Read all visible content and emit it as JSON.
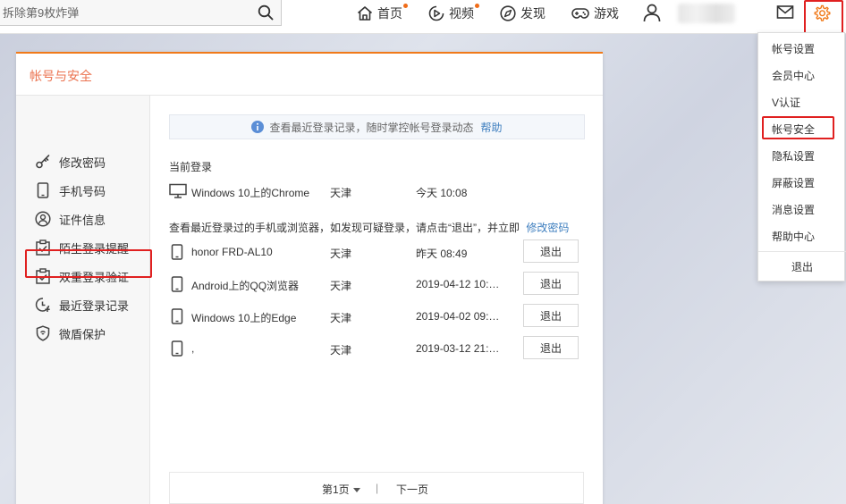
{
  "topbar": {
    "search_placeholder": "拆除第9枚炸弹",
    "nav": [
      {
        "label": "首页",
        "icon": "home-icon"
      },
      {
        "label": "视频",
        "icon": "video-icon"
      },
      {
        "label": "发现",
        "icon": "discover-icon"
      },
      {
        "label": "游戏",
        "icon": "game-icon"
      }
    ],
    "icons": [
      "user-icon",
      "mail-icon",
      "gear-icon"
    ],
    "accent": "#f07a1a",
    "highlight": "#e02020"
  },
  "panel": {
    "title": "帐号与安全",
    "sidebar": [
      {
        "label": "修改密码",
        "icon": "key-icon"
      },
      {
        "label": "手机号码",
        "icon": "phone-icon"
      },
      {
        "label": "证件信息",
        "icon": "id-icon"
      },
      {
        "label": "陌生登录提醒",
        "icon": "clipboard-check-icon"
      },
      {
        "label": "双重登录验证",
        "icon": "clipboard-check-icon"
      },
      {
        "label": "最近登录记录",
        "icon": "clock-plus-icon"
      },
      {
        "label": "微盾保护",
        "icon": "shield-icon"
      }
    ],
    "notice": {
      "text": "查看最近登录记录，随时掌控帐号登录动态",
      "link": "帮助"
    },
    "current_label": "当前登录",
    "current": {
      "device": "Windows 10上的Chrome",
      "location": "天津",
      "time": "今天 10:08"
    },
    "recent_label": "查看最近登录过的手机或浏览器，如发现可疑登录，请点击“退出”，并立即",
    "recent_link": "修改密码",
    "recent": [
      {
        "device": "honor FRD-AL10",
        "location": "天津",
        "time": "昨天 08:49",
        "action": "退出",
        "icon": "phone-icon"
      },
      {
        "device": "Android上的QQ浏览器",
        "location": "天津",
        "time": "2019-04-12 10:…",
        "action": "退出",
        "icon": "phone-icon"
      },
      {
        "device": "Windows 10上的Edge",
        "location": "天津",
        "time": "2019-04-02 09:…",
        "action": "退出",
        "icon": "phone-icon"
      },
      {
        "device": ",",
        "location": "天津",
        "time": "2019-03-12 21:…",
        "action": "退出",
        "icon": "phone-icon"
      }
    ],
    "pager": {
      "page": "第1页",
      "next": "下一页",
      "sep": "|"
    }
  },
  "menu": {
    "items": [
      "帐号设置",
      "会员中心",
      "V认证",
      "帐号安全",
      "隐私设置",
      "屏蔽设置",
      "消息设置",
      "帮助中心"
    ],
    "logout": "退出"
  }
}
